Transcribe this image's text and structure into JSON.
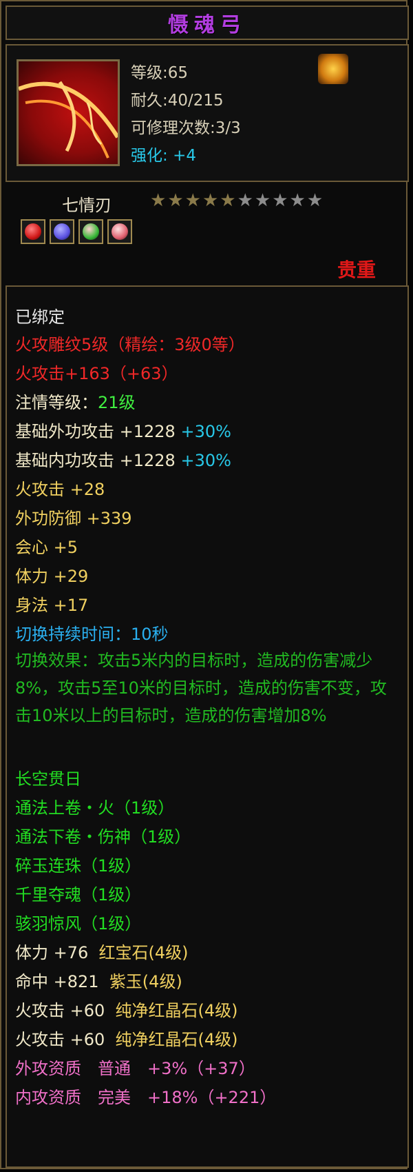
{
  "title": "慑魂弓",
  "header": {
    "level": "等级:65",
    "durability": "耐久:40/215",
    "repairs": "可修理次数:3/3",
    "enhance_label": "强化:",
    "enhance_value": "+4",
    "item_icon": "bow-icon",
    "class_icon": "fire-class-icon"
  },
  "weapon_type": "七情刃",
  "stars": {
    "filled": 5,
    "total": 10
  },
  "gems": [
    {
      "icon": "red-gem-icon",
      "color": "#d01818"
    },
    {
      "icon": "purple-gem-icon",
      "color": "#5a50e0"
    },
    {
      "icon": "green-gem-icon",
      "color": "#38b838"
    },
    {
      "icon": "pink-gem-icon",
      "color": "#e06070"
    }
  ],
  "rarity": "贵重",
  "stats": {
    "bound": "已绑定",
    "engrave": "火攻雕纹5级（精绘：3级0等）",
    "fire_attack_main": "火攻击+163（+63）",
    "infuse_level_label": "注情等级：",
    "infuse_level_value": "21级",
    "base_outer_label": "基础外功攻击 +1228",
    "base_outer_pct": "+30%",
    "base_inner_label": "基础内功攻击 +1228",
    "base_inner_pct": "+30%",
    "fire_attack": "火攻击 +28",
    "outer_defense": "外功防御 +339",
    "crit": "会心 +5",
    "stamina": "体力 +29",
    "agility": "身法 +17",
    "switch_duration_label": "切换持续时间：",
    "switch_duration_value": "10秒",
    "switch_effect": "切换效果：攻击5米内的目标时，造成的伤害减少8%，攻击5至10米的目标时，造成的伤害不变，攻击10米以上的目标时，造成的伤害增加8%",
    "skill_1": "长空贯日",
    "skill_2": "通法上卷・火（1级）",
    "skill_3": "通法下卷・伤神（1级）",
    "skill_4": "碎玉连珠（1级）",
    "skill_5": "千里夺魂（1级）",
    "skill_6": "骇羽惊风（1级）",
    "gem_stat_1": "体力 +76",
    "gem_name_1": "红宝石(4级)",
    "gem_stat_2": "命中 +821",
    "gem_name_2": "紫玉(4级)",
    "gem_stat_3": "火攻击 +60",
    "gem_name_3": "纯净红晶石(4级)",
    "gem_stat_4": "火攻击 +60",
    "gem_name_4": "纯净红晶石(4级)",
    "outer_quality": "外攻资质　普通　+3%（+37）",
    "inner_quality": "内攻资质　完美　+18%（+221）"
  },
  "colors": {
    "title": "#b23de0",
    "rarity": "#e01818",
    "star_filled": "#8a7a4a",
    "star_empty": "#8c8c8c"
  }
}
